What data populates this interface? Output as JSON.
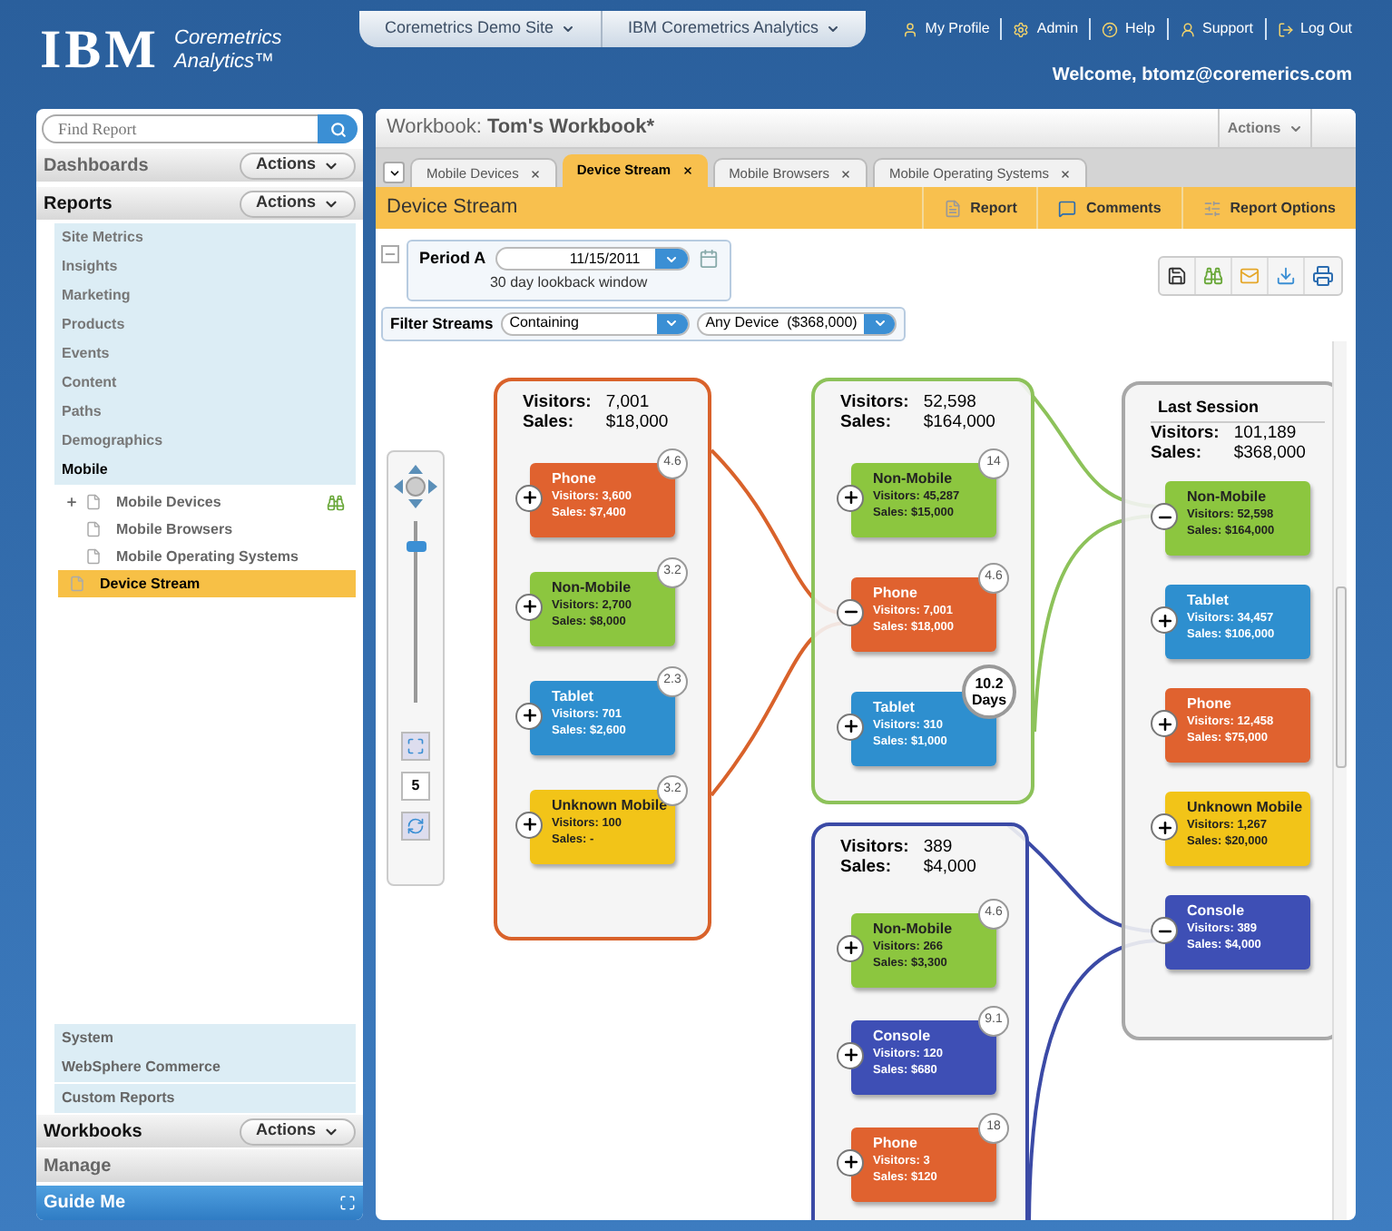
{
  "header": {
    "logo": "IBM",
    "product": [
      "Coremetrics",
      "Analytics™"
    ],
    "menus": [
      {
        "label": "Coremetrics Demo Site"
      },
      {
        "label": "IBM Coremetrics Analytics"
      }
    ],
    "links": [
      {
        "kind": "profile",
        "label": "My Profile"
      },
      {
        "kind": "admin",
        "label": "Admin"
      },
      {
        "kind": "help",
        "label": "Help"
      },
      {
        "kind": "support",
        "label": "Support"
      },
      {
        "kind": "logout",
        "label": "Log Out"
      }
    ],
    "welcome": "Welcome, btomz@coremerics.com"
  },
  "sidebar": {
    "search": {
      "placeholder": "Find Report"
    },
    "sections": [
      {
        "label": "Dashboards",
        "action": "Actions",
        "selected": false
      },
      {
        "label": "Reports",
        "action": "Actions",
        "selected": true,
        "items": [
          {
            "label": "Site Metrics",
            "expanded": false
          },
          {
            "label": "Insights",
            "expanded": false
          },
          {
            "label": "Marketing",
            "expanded": false
          },
          {
            "label": "Products",
            "expanded": false
          },
          {
            "label": "Events",
            "expanded": false
          },
          {
            "label": "Content",
            "expanded": false
          },
          {
            "label": "Paths",
            "expanded": false
          },
          {
            "label": "Demographics",
            "expanded": false
          },
          {
            "label": "Mobile",
            "expanded": true,
            "children": [
              {
                "kind": "group",
                "label": "Mobile Devices",
                "selected": false
              },
              {
                "kind": "report",
                "label": "Mobile Browsers",
                "selected": false
              },
              {
                "kind": "report",
                "label": "Mobile Operating Systems",
                "selected": false
              },
              {
                "kind": "report",
                "label": "Device Stream",
                "selected": true
              }
            ]
          }
        ]
      }
    ],
    "bottom_items": [
      {
        "label": "System"
      },
      {
        "label": "WebSphere Commerce"
      },
      {
        "label": "Custom Reports"
      }
    ],
    "bottom_sections": [
      {
        "label": "Workbooks",
        "action": "Actions",
        "selected": true
      },
      {
        "label": "Manage",
        "selected": false
      }
    ],
    "guide": "Guide Me"
  },
  "workbook": {
    "label": "Workbook:",
    "name": "Tom's Workbook*",
    "action": "Actions",
    "tabs": [
      {
        "label": "Mobile Devices",
        "selected": false
      },
      {
        "label": "Device Stream",
        "selected": true
      },
      {
        "label": "Mobile Browsers",
        "selected": false
      },
      {
        "label": "Mobile Operating Systems",
        "selected": false
      }
    ],
    "report": {
      "title": "Device Stream",
      "buttons": [
        {
          "kind": "report",
          "label": "Report"
        },
        {
          "kind": "comments",
          "label": "Comments"
        },
        {
          "kind": "options",
          "label": "Report Options"
        }
      ]
    },
    "period": {
      "label": "Period A",
      "date": "11/15/2011",
      "note": "30 day lookback window"
    },
    "filter": {
      "label": "Filter Streams",
      "mode": "Containing",
      "device": "Any Device  ($368,000)"
    }
  },
  "stream": {
    "zoom_value": "5",
    "zoom": {
      "level": 0.88
    },
    "tooltip": "10.2 Days",
    "panels": [
      {
        "color": "#d9622b",
        "visitors_label": "Visitors:",
        "sales_label": "Sales:",
        "visitors": "7,001",
        "sales": "$18,000",
        "nodes": [
          {
            "name": "Phone",
            "visitors": "Visitors: 3,600",
            "sales": "Sales: $7,400",
            "badge": "4.6",
            "expanded": false,
            "color": "#e0622f"
          },
          {
            "name": "Non-Mobile",
            "visitors": "Visitors: 2,700",
            "sales": "Sales: $8,000",
            "badge": "3.2",
            "expanded": false,
            "color": "#8cc63f"
          },
          {
            "name": "Tablet",
            "visitors": "Visitors: 701",
            "sales": "Sales: $2,600",
            "badge": "2.3",
            "expanded": false,
            "color": "#2e8fcf"
          },
          {
            "name": "Unknown Mobile",
            "visitors": "Visitors: 100",
            "sales": "Sales: -",
            "badge": "3.2",
            "expanded": false,
            "color": "#f2c418"
          }
        ]
      },
      {
        "color": "#8dc25a",
        "visitors_label": "Visitors:",
        "sales_label": "Sales:",
        "visitors": "52,598",
        "sales": "$164,000",
        "nodes": [
          {
            "name": "Non-Mobile",
            "visitors": "Visitors: 45,287",
            "sales": "Sales: $15,000",
            "badge": "14",
            "expanded": false,
            "color": "#8cc63f"
          },
          {
            "name": "Phone",
            "visitors": "Visitors: 7,001",
            "sales": "Sales: $18,000",
            "badge": "4.6",
            "expanded": true,
            "color": "#e0622f"
          },
          {
            "name": "Tablet",
            "visitors": "Visitors: 310",
            "sales": "Sales: $1,000",
            "expanded": false,
            "color": "#2e8fcf"
          }
        ]
      },
      {
        "color": "#3b4aa6",
        "visitors_label": "Visitors:",
        "sales_label": "Sales:",
        "visitors": "389",
        "sales": "$4,000",
        "nodes": [
          {
            "name": "Non-Mobile",
            "visitors": "Visitors: 266",
            "sales": "Sales: $3,300",
            "badge": "4.6",
            "expanded": false,
            "color": "#8cc63f"
          },
          {
            "name": "Console",
            "visitors": "Visitors: 120",
            "sales": "Sales: $680",
            "badge": "9.1",
            "expanded": false,
            "color": "#3e4fb5"
          },
          {
            "name": "Phone",
            "visitors": "Visitors: 3",
            "sales": "Sales: $120",
            "badge": "18",
            "expanded": false,
            "color": "#e0622f"
          }
        ]
      },
      {
        "color": "#a8a8a8",
        "title": "Last Session",
        "visitors_label": "Visitors:",
        "sales_label": "Sales:",
        "visitors": "101,189",
        "sales": "$368,000",
        "nodes": [
          {
            "name": "Non-Mobile",
            "visitors": "Visitors: 52,598",
            "sales": "Sales: $164,000",
            "expanded": true,
            "color": "#8cc63f"
          },
          {
            "name": "Tablet",
            "visitors": "Visitors: 34,457",
            "sales": "Sales: $106,000",
            "expanded": false,
            "color": "#2e8fcf"
          },
          {
            "name": "Phone",
            "visitors": "Visitors: 12,458",
            "sales": "Sales: $75,000",
            "expanded": false,
            "color": "#e0622f"
          },
          {
            "name": "Unknown Mobile",
            "visitors": "Visitors: 1,267",
            "sales": "Sales: $20,000",
            "expanded": false,
            "color": "#f2c418"
          },
          {
            "name": "Console",
            "visitors": "Visitors: 389",
            "sales": "Sales: $4,000",
            "expanded": true,
            "color": "#3e4fb5"
          }
        ]
      }
    ]
  }
}
